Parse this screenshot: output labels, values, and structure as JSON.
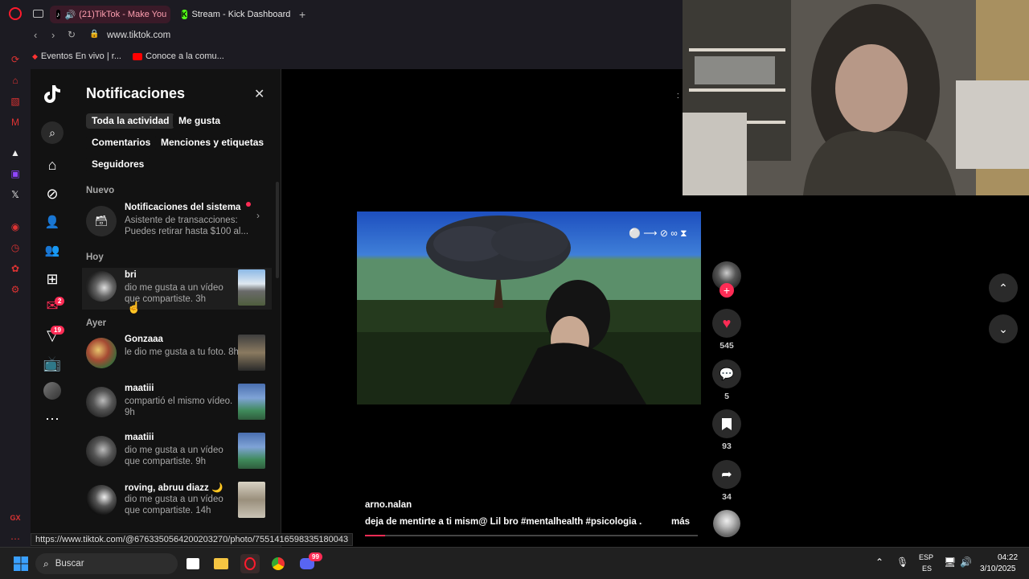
{
  "browser": {
    "tabs": [
      {
        "label": "(21)TikTok - Make You"
      },
      {
        "label": "Stream - Kick Dashboard"
      }
    ],
    "url": "www.tiktok.com",
    "bookmarks": [
      {
        "label": "Eventos En vivo | r..."
      },
      {
        "label": "Conoce a la comu..."
      }
    ],
    "status_url": "https://www.tiktok.com/@6763350564200203270/photo/7551416598335180043",
    "sidebar_label": "GX"
  },
  "rail": {
    "messages_badge": "2",
    "activity_badge": "19"
  },
  "notifications": {
    "title": "Notificaciones",
    "filters": [
      "Toda la actividad",
      "Me gusta",
      "Comentarios",
      "Menciones y etiquetas",
      "Seguidores"
    ],
    "sections": {
      "new": "Nuevo",
      "today": "Hoy",
      "yesterday": "Ayer"
    },
    "system": {
      "name": "Notificaciones del sistema",
      "message": "Asistente de transacciones: Puedes retirar hasta $100 al..."
    },
    "items": [
      {
        "name": "bri",
        "message": "dio me gusta a un vídeo que compartiste. 3h"
      },
      {
        "name": "Gonzaaa",
        "message": "le dio me gusta a tu foto. 8h"
      },
      {
        "name": "maatiii",
        "message": "compartió el mismo vídeo. 9h"
      },
      {
        "name": "maatiii",
        "message": "dio me gusta a un vídeo que compartiste. 9h"
      },
      {
        "name": "roving, abruu diazz 🌙",
        "message": "dio me gusta a un vídeo que compartiste. 14h"
      }
    ]
  },
  "video": {
    "overlay_text": "⚪ ⟶ ⊘ ∞ ⧗",
    "author": "arno.nalan",
    "caption": "deja de mentirte a ti mism@ Lil bro #mentalhealth #psicologia ...",
    "more_label": "más",
    "progress": 0.06,
    "likes": "545",
    "comments": "5",
    "saves": "93",
    "shares": "34"
  },
  "taskbar": {
    "search_placeholder": "Buscar",
    "language_line1": "ESP",
    "language_line2": "ES",
    "time": "04:22",
    "date": "3/10/2025",
    "discord_badge": "99"
  }
}
